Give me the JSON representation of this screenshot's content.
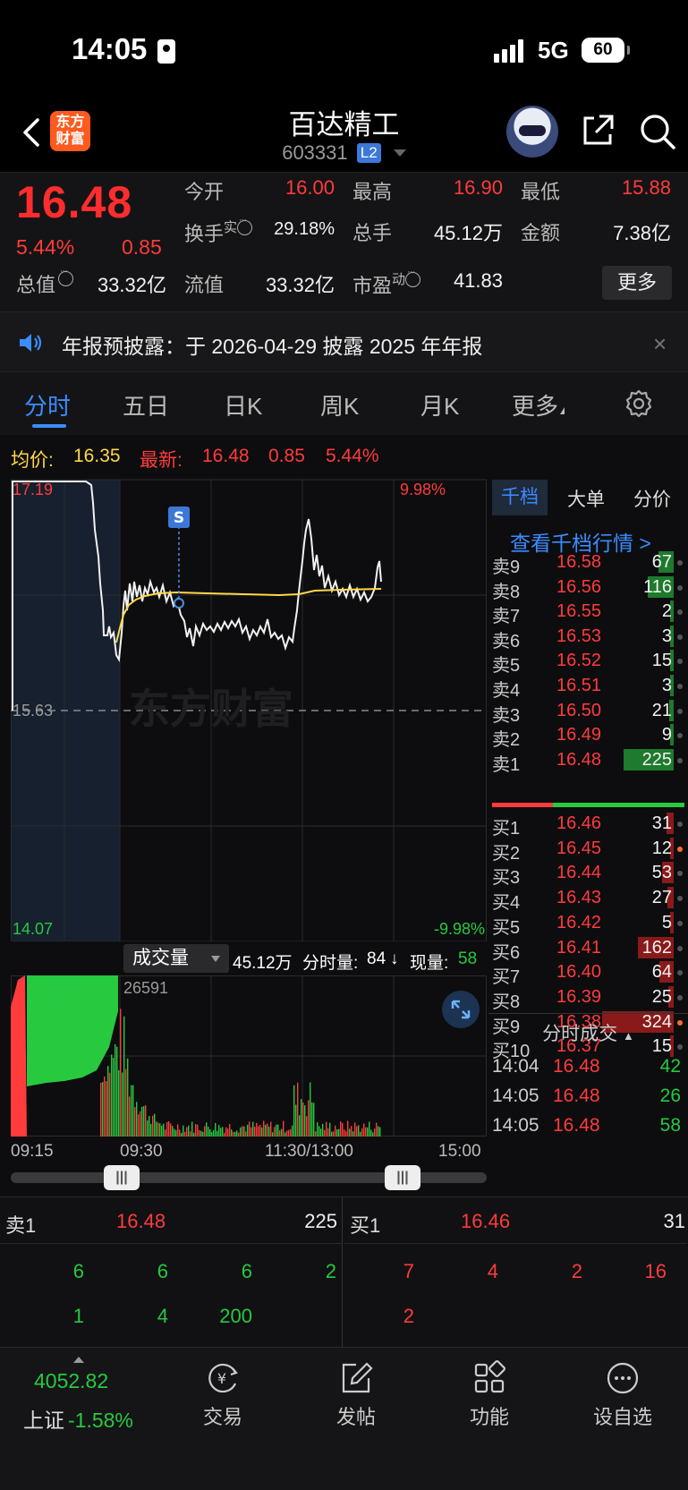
{
  "status_bar": {
    "time": "14:05",
    "network": "5G",
    "battery": "60"
  },
  "header": {
    "stock_name": "百达精工",
    "stock_code": "603331",
    "badge": "L2"
  },
  "quote": {
    "price": "16.48",
    "pct": "5.44%",
    "change": "0.85",
    "open_label": "今开",
    "open": "16.00",
    "high_label": "最高",
    "high": "16.90",
    "low_label": "最低",
    "low": "15.88",
    "turnover_label": "换手",
    "turnover_sup": "实",
    "turnover": "29.18%",
    "volume_label": "总手",
    "volume": "45.12万",
    "amount_label": "金额",
    "amount": "7.38亿",
    "mktcap_label": "总值",
    "mktcap": "33.32亿",
    "float_label": "流值",
    "float": "33.32亿",
    "pe_label": "市盈",
    "pe_sup": "动",
    "pe": "41.83",
    "more": "更多"
  },
  "notice": {
    "text": "年报预披露：于 2026-04-29 披露 2025 年年报",
    "close": "×"
  },
  "tabs": [
    "分时",
    "五日",
    "日K",
    "周K",
    "月K",
    "更多"
  ],
  "chart_info": {
    "avg_label": "均价:",
    "avg": "16.35",
    "latest_label": "最新:",
    "latest": "16.48",
    "change": "0.85",
    "pct": "5.44%"
  },
  "chart_labels": {
    "top_price": "17.19",
    "mid_price": "15.63",
    "bottom_price": "14.07",
    "top_pct": "9.98%",
    "bottom_pct": "-9.98%",
    "signal": "S",
    "watermark": "东方财富"
  },
  "volume_panel": {
    "selector": "成交量",
    "total": "45.12万",
    "minute_label": "分时量:",
    "minute": "84",
    "arrow": "↓",
    "current_label": "现量:",
    "current": "58",
    "max": "26591"
  },
  "time_axis": [
    "09:15",
    "09:30",
    "11:30/13:00",
    "15:00"
  ],
  "order_book": {
    "tabs": [
      "千档",
      "大单",
      "分价"
    ],
    "link": "查看千档行情 >",
    "asks": [
      {
        "label": "卖9",
        "price": "16.58",
        "vol": "67"
      },
      {
        "label": "卖8",
        "price": "16.56",
        "vol": "116"
      },
      {
        "label": "卖7",
        "price": "16.55",
        "vol": "2"
      },
      {
        "label": "卖6",
        "price": "16.53",
        "vol": "3"
      },
      {
        "label": "卖5",
        "price": "16.52",
        "vol": "15"
      },
      {
        "label": "卖4",
        "price": "16.51",
        "vol": "3"
      },
      {
        "label": "卖3",
        "price": "16.50",
        "vol": "21"
      },
      {
        "label": "卖2",
        "price": "16.49",
        "vol": "9"
      },
      {
        "label": "卖1",
        "price": "16.48",
        "vol": "225"
      }
    ],
    "bids": [
      {
        "label": "买1",
        "price": "16.46",
        "vol": "31"
      },
      {
        "label": "买2",
        "price": "16.45",
        "vol": "12"
      },
      {
        "label": "买3",
        "price": "16.44",
        "vol": "53"
      },
      {
        "label": "买4",
        "price": "16.43",
        "vol": "27"
      },
      {
        "label": "买5",
        "price": "16.42",
        "vol": "5"
      },
      {
        "label": "买6",
        "price": "16.41",
        "vol": "162"
      },
      {
        "label": "买7",
        "price": "16.40",
        "vol": "64"
      },
      {
        "label": "买8",
        "price": "16.39",
        "vol": "25"
      },
      {
        "label": "买9",
        "price": "16.38",
        "vol": "324"
      },
      {
        "label": "买10",
        "price": "16.37",
        "vol": "15"
      }
    ],
    "trades_title": "分时成交",
    "trades": [
      {
        "time": "14:04",
        "price": "16.48",
        "vol": "42"
      },
      {
        "time": "14:05",
        "price": "16.48",
        "vol": "26"
      },
      {
        "time": "14:05",
        "price": "16.48",
        "vol": "58"
      }
    ]
  },
  "l2_queue": {
    "ask_label": "卖1",
    "ask_price": "16.48",
    "ask_vol": "225",
    "bid_label": "买1",
    "bid_price": "16.46",
    "bid_vol": "31",
    "ask_orders": [
      "6",
      "6",
      "6",
      "2",
      "1",
      "4",
      "200"
    ],
    "bid_orders": [
      "7",
      "4",
      "2",
      "16",
      "2"
    ]
  },
  "bottom_nav": {
    "index_value": "4052.82",
    "index_name": "上证",
    "index_pct": "-1.58%",
    "items": [
      "交易",
      "发帖",
      "功能",
      "设自选"
    ]
  },
  "colors": {
    "up": "#ff3b3b",
    "down": "#27c93f",
    "accent": "#3b8cff",
    "avg_line": "#ffd84a"
  }
}
